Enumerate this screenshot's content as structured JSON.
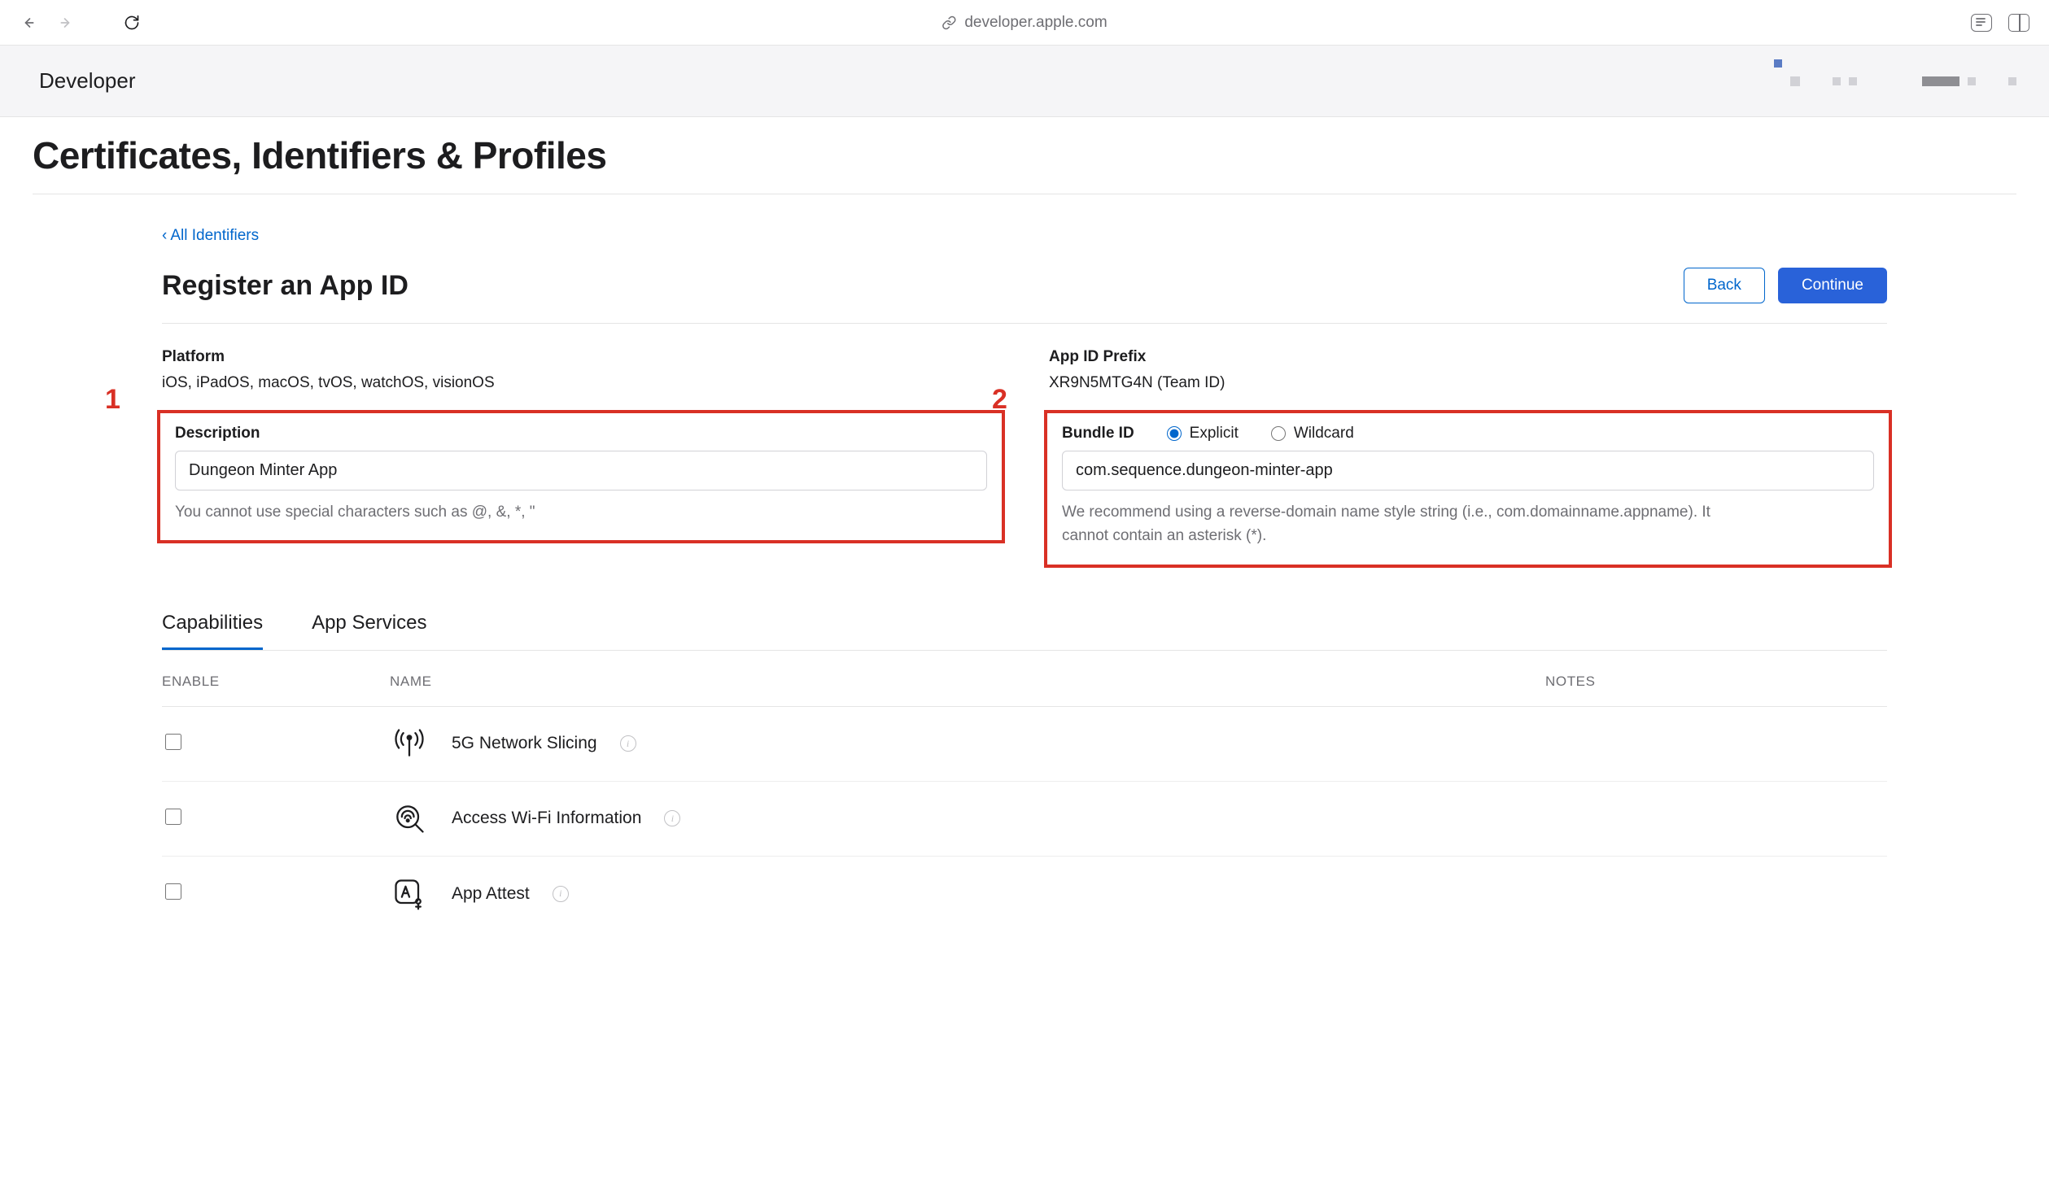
{
  "browser": {
    "url_host": "developer.apple.com"
  },
  "global_nav": {
    "brand": "Developer"
  },
  "page": {
    "title": "Certificates, Identifiers & Profiles",
    "breadcrumb": "All Identifiers",
    "section_title": "Register an App ID",
    "buttons": {
      "back": "Back",
      "continue": "Continue"
    }
  },
  "platform": {
    "label": "Platform",
    "value": "iOS, iPadOS, macOS, tvOS, watchOS, visionOS"
  },
  "description": {
    "label": "Description",
    "value": "Dungeon Minter App",
    "hint": "You cannot use special characters such as @, &, *, \""
  },
  "appid_prefix": {
    "label": "App ID Prefix",
    "value": "XR9N5MTG4N (Team ID)"
  },
  "bundle": {
    "label": "Bundle ID",
    "radio_explicit": "Explicit",
    "radio_wildcard": "Wildcard",
    "selected": "explicit",
    "value": "com.sequence.dungeon-minter-app",
    "hint": "We recommend using a reverse-domain name style string (i.e., com.domainname.appname). It cannot contain an asterisk (*)."
  },
  "annotations": {
    "one": "1",
    "two": "2"
  },
  "tabs": {
    "capabilities": "Capabilities",
    "app_services": "App Services"
  },
  "cap_table": {
    "headers": {
      "enable": "ENABLE",
      "name": "NAME",
      "notes": "NOTES"
    },
    "rows": [
      {
        "name": "5G Network Slicing",
        "icon": "antenna"
      },
      {
        "name": "Access Wi-Fi Information",
        "icon": "wifi-search"
      },
      {
        "name": "App Attest",
        "icon": "app-attest"
      }
    ]
  }
}
